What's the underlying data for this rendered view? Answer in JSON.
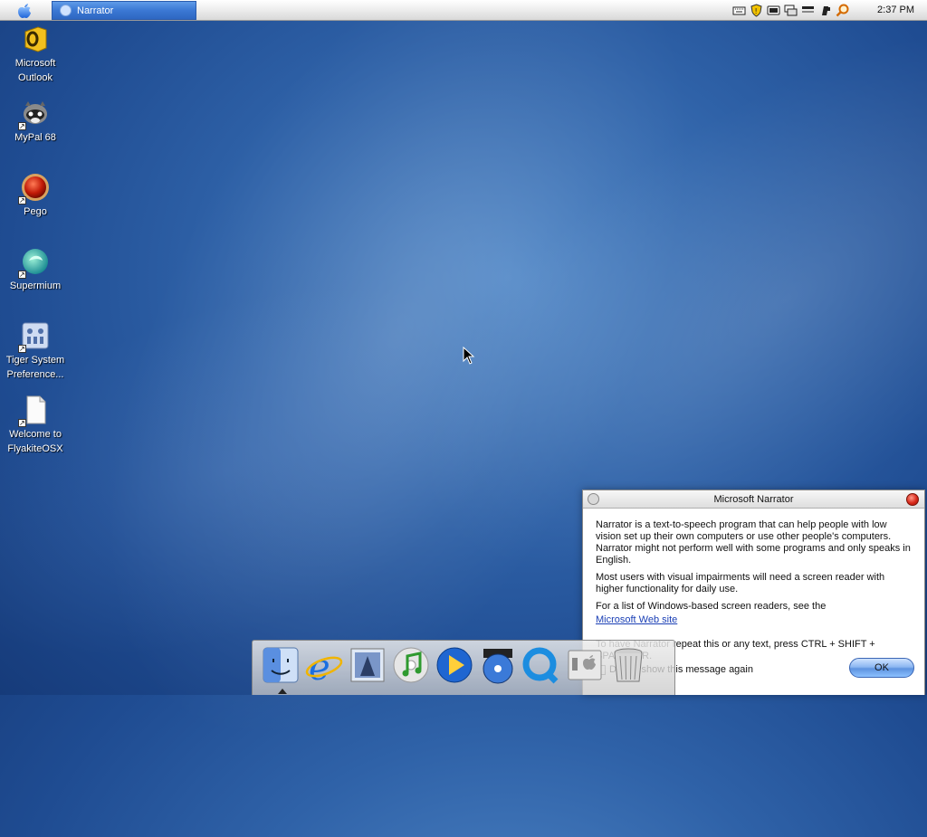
{
  "menubar": {
    "task_button_label": "Narrator",
    "clock": "2:37 PM",
    "tray_icons": [
      "keyboard-icon",
      "shield-icon",
      "display-icon",
      "network-icon",
      "network-bars-icon",
      "usb-icon",
      "search-icon"
    ]
  },
  "desktop": {
    "icons": [
      {
        "label": "Microsoft Outlook",
        "icon": "outlook-icon"
      },
      {
        "label": "MyPal 68",
        "icon": "raccoon-icon"
      },
      {
        "label": "Pego",
        "icon": "red-orb-icon"
      },
      {
        "label": "Supermium",
        "icon": "supermium-icon"
      },
      {
        "label": "Tiger System Preference...",
        "icon": "system-preferences-icon"
      },
      {
        "label": "Welcome to FlyakiteOSX",
        "icon": "document-icon"
      }
    ]
  },
  "dialog": {
    "title": "Microsoft Narrator",
    "paragraph1": "Narrator is a text-to-speech program that can help people with low vision set up their own computers or use other people's computers. Narrator might not perform well with some programs and only speaks in English.",
    "paragraph2": "Most users with visual impairments will need a screen reader with higher functionality for daily use.",
    "paragraph3": "For a list of Windows-based screen readers, see the",
    "link": "Microsoft Web site",
    "paragraph4": "To have Narrator repeat this or any text, press CTRL + SHIFT + SPACEBAR.",
    "checkbox_label": "Do not show this message again",
    "ok_label": "OK"
  },
  "dock": {
    "items": [
      "finder-icon",
      "internet-explorer-icon",
      "mail-icon",
      "itunes-icon",
      "media-player-icon",
      "dvd-player-icon",
      "quicktime-icon",
      "system-icon",
      "trash-icon"
    ]
  },
  "colors": {
    "menu_task_blue": "#3b78d4",
    "desktop_blue": "#2f62a8",
    "close_red": "#d8281a",
    "ok_blue": "#8db8f2",
    "link_blue": "#1a3fb5"
  }
}
